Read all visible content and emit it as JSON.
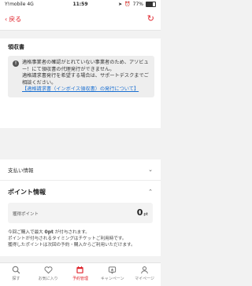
{
  "status": {
    "carrier": "Y!mobile",
    "network": "4G",
    "time": "11:59",
    "battery_percent": "77%",
    "battery_level": 0.77
  },
  "nav": {
    "back_label": "戻る"
  },
  "receipt": {
    "title": "領収書",
    "notice_line1": "適格事業者の確認がとれていない事業者のため、アソビュー！にて領収書の代理発行ができません。",
    "notice_line2": "適格請求書発行を希望する場合は、サポートデスクまでご相談ください。",
    "notice_link": "【適格請求書（インボイス領収書）の発行について】"
  },
  "payment": {
    "label": "支払い情報"
  },
  "points": {
    "title": "ポイント情報",
    "earned_label": "獲得ポイント",
    "value": "0",
    "unit": "pt",
    "note_prefix": "今回ご購入で最大 ",
    "note_points": "0pt",
    "note_suffix": " が付与されます。",
    "note_line2": "ポイントが付与されるタイミングはチケットご利用時です。",
    "note_line3": "獲得したポイントは次回の予約・購入からご利用いただけます。"
  },
  "tabs": [
    {
      "label": "探す",
      "icon": "search-icon"
    },
    {
      "label": "お気に入り",
      "icon": "heart-icon"
    },
    {
      "label": "予約管理",
      "icon": "calendar-icon"
    },
    {
      "label": "キャンペーン",
      "icon": "campaign-icon"
    },
    {
      "label": "マイページ",
      "icon": "person-icon"
    }
  ],
  "colors": {
    "accent": "#e0262e",
    "link": "#1a6fd1"
  }
}
